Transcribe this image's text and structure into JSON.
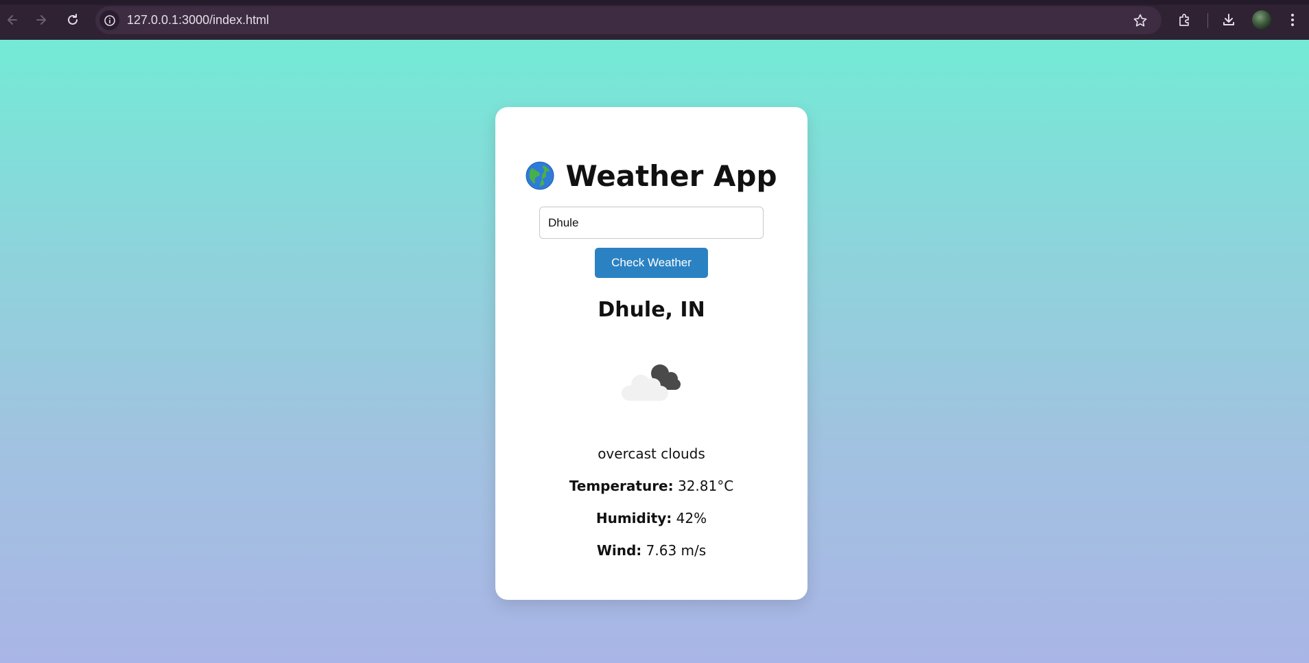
{
  "browser": {
    "url": "127.0.0.1:3000/index.html"
  },
  "app": {
    "title": "Weather App",
    "title_emoji": "🌍",
    "search": {
      "value": "Dhule",
      "button_label": "Check Weather"
    },
    "result": {
      "location": "Dhule, IN",
      "icon": "overcast-cloud-icon",
      "description": "overcast clouds",
      "temperature_label": "Temperature:",
      "temperature_value": "32.81°C",
      "humidity_label": "Humidity:",
      "humidity_value": "42%",
      "wind_label": "Wind:",
      "wind_value": "7.63 m/s"
    }
  },
  "colors": {
    "button": "#2b82c2",
    "gradient_top": "#74ead6",
    "gradient_bottom": "#a9b5e6",
    "browser_chrome": "#2f2233"
  }
}
